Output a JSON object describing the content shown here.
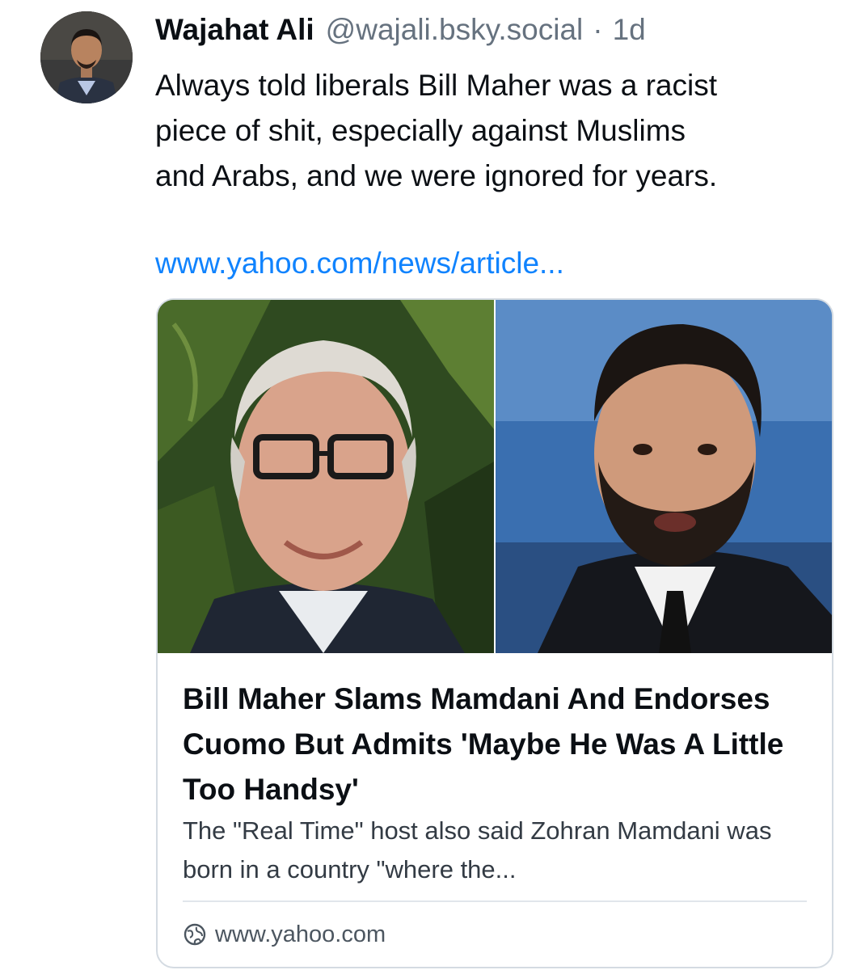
{
  "post": {
    "author_name": "Wajahat Ali",
    "author_handle": "@wajali.bsky.social",
    "separator": "·",
    "timestamp": "1d",
    "text_lines": [
      "Always told liberals Bill Maher was a racist",
      "piece of shit, especially against Muslims",
      "and Arabs, and we were ignored for years."
    ],
    "link_text": "www.yahoo.com/news/article..."
  },
  "link_card": {
    "title": "Bill Maher Slams Mamdani And Endorses Cuomo But Admits 'Maybe He Was A Little Too Handsy'",
    "description": "The \"Real Time\" host also said Zohran Mamdani was born in a country \"where the...",
    "domain": "www.yahoo.com",
    "domain_icon": "globe-icon"
  },
  "colors": {
    "link": "#1083fe",
    "secondary_text": "#66727f",
    "card_border": "#d4dbe2"
  }
}
